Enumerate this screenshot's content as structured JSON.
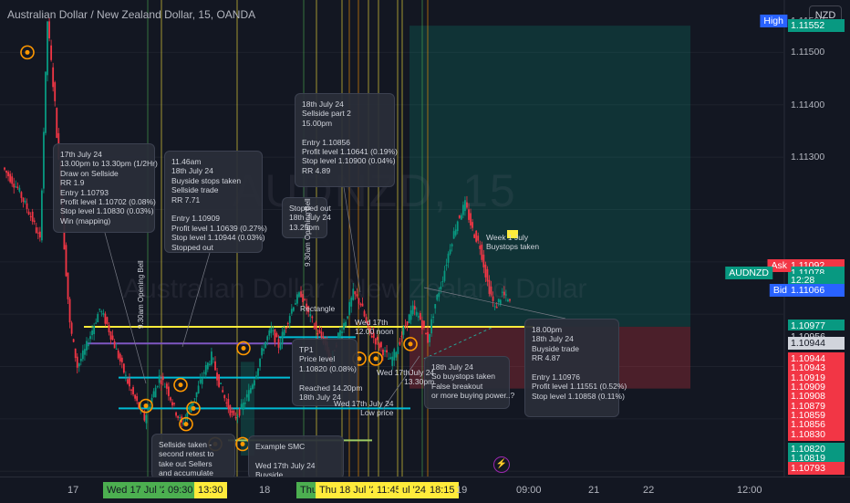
{
  "header": {
    "title": "Australian Dollar / New Zealand Dollar, 15, OANDA",
    "currency_button": "NZD"
  },
  "watermark": {
    "symbol": "AUDNZD, 15",
    "name": "Australian Dollar / New Zealand Dollar"
  },
  "price_labels": [
    {
      "text": "1.11560",
      "price": 1.1156,
      "bg": "transparent"
    },
    {
      "text": "1.11552",
      "price": 1.11552,
      "bg": "#089981"
    },
    {
      "text": "1.11500",
      "price": 1.115,
      "bg": "transparent"
    },
    {
      "text": "1.11400",
      "price": 1.114,
      "bg": "transparent"
    },
    {
      "text": "1.11300",
      "price": 1.113,
      "bg": "transparent"
    },
    {
      "text": "1.11092",
      "price": 1.11092,
      "bg": "#f23645"
    },
    {
      "text": "1.11078",
      "price": 1.11078,
      "bg": "#089981"
    },
    {
      "text": "12:28",
      "price": 1.11064,
      "bg": "#089981"
    },
    {
      "text": "1.11066",
      "price": 1.11046,
      "bg": "#2962ff"
    },
    {
      "text": "1.10977",
      "price": 1.10977,
      "bg": "#089981"
    },
    {
      "text": "1.10956",
      "price": 1.10956,
      "bg": "#131722",
      "color": "#d1d4dc"
    },
    {
      "text": "1.10944",
      "price": 1.10944,
      "bg": "#d1d4dc",
      "color": "#131722"
    },
    {
      "text": "1.10944",
      "price": 1.10915,
      "bg": "#f23645"
    },
    {
      "text": "1.10943",
      "price": 1.10897,
      "bg": "#f23645"
    },
    {
      "text": "1.10919",
      "price": 1.10879,
      "bg": "#f23645"
    },
    {
      "text": "1.10909",
      "price": 1.10861,
      "bg": "#f23645"
    },
    {
      "text": "1.10908",
      "price": 1.10843,
      "bg": "#f23645"
    },
    {
      "text": "1.10879",
      "price": 1.10825,
      "bg": "#f23645"
    },
    {
      "text": "1.10859",
      "price": 1.10807,
      "bg": "#f23645"
    },
    {
      "text": "1.10856",
      "price": 1.10789,
      "bg": "#f23645"
    },
    {
      "text": "1.10830",
      "price": 1.10771,
      "bg": "#f23645"
    },
    {
      "text": "1.10820",
      "price": 1.10743,
      "bg": "#089981"
    },
    {
      "text": "1.10819",
      "price": 1.10725,
      "bg": "#089981"
    },
    {
      "text": "1.10793",
      "price": 1.10705,
      "bg": "#f23645"
    }
  ],
  "price_tags": [
    {
      "text": "High",
      "price": 1.1156,
      "bg": "#2962ff"
    },
    {
      "text": "Ask",
      "price": 1.11092,
      "bg": "#f23645"
    },
    {
      "text": "AUDNZD",
      "price": 1.11078,
      "bg": "#089981"
    },
    {
      "text": "Bid",
      "price": 1.11046,
      "bg": "#2962ff"
    }
  ],
  "time_axis": {
    "ticks": [
      "17",
      "18",
      "19",
      "09:00",
      "21",
      "22",
      "12:00"
    ],
    "highlights": [
      {
        "text": "Wed 17 Jul '24",
        "bg": "#4caf50"
      },
      {
        "text": "09:30",
        "bg": "#4caf50"
      },
      {
        "text": "13:30",
        "bg": "#ffeb3b"
      },
      {
        "text": "Thu",
        "bg": "#4caf50"
      },
      {
        "text": "Thu 18 Jul '24",
        "bg": "#ffeb3b"
      },
      {
        "text": "11:45",
        "bg": "#ffeb3b"
      },
      {
        "text": "ul '24",
        "bg": "#ffeb3b"
      },
      {
        "text": "18:15",
        "bg": "#ffeb3b"
      }
    ]
  },
  "notes": {
    "n1": "17th July 24\n13.00pm to 13.30pm (1/2Hr)\nDraw on Sellside\nRR 1.9\nEntry 1.10793\nProfit level 1.10702 (0.08%)\nStop level 1.10830 (0.03%)\nWin (mapping)",
    "n2": "11.46am\n18th July 24\nBuyside stops taken\nSellside trade\nRR 7.71\n\nEntry 1.10909\nProfit level 1.10639 (0.27%)\nStop level 1.10944 (0.03%)\nStopped out",
    "n3": "18th July 24\nSellside part 2\n15.00pm\n\nEntry 1.10856\nProfit level 1.10641 (0.19%)\nStop level 1.10900 (0.04%)\nRR 4.89",
    "n4": "Stopped out\n18th July 24\n13.25pm",
    "n5": "TP1\nPrice level\n1.10820 (0.08%)\n\nReached 14.20pm\n18th July 24",
    "n6": "18th July 24\nSo buystops taken\nFalse breakout\nor more buying power..?",
    "n7": "18.00pm\n18th July 24\nBuyside trade\nRR 4.87\n\nEntry 1.10976\nProfit level 1.11551 (0.52%)\nStop level 1.10858 (0.11%)",
    "n8": "Sellside taken -\nsecond retest to\ntake out Sellers\nand accumulate",
    "n9": "Example SMC\n\nWed 17th July 24\nBuyside"
  },
  "labels": {
    "wed13": "Wed 17thJuly 24\n13.30pm",
    "wed11": "Wed 17th July 24\nLow price",
    "wed12": "Wed 17th\n12.00 noon",
    "rect": "Rectangle",
    "week": "Week 1 July\nBuystops taken",
    "open930": "9.30am Opening Bell",
    "open930b": "9.30am Opening Bell"
  },
  "chart_data": {
    "type": "candlestick",
    "symbol": "AUDNZD",
    "timeframe": "15",
    "source": "OANDA",
    "ylim": [
      1.1069,
      1.116
    ],
    "x_ticks": [
      "17",
      "18",
      "19",
      "09:00",
      "21",
      "22",
      "12:00"
    ],
    "close_path": [
      1.1128,
      1.1126,
      1.1124,
      1.1121,
      1.1118,
      1.1114,
      1.1156,
      1.114,
      1.1118,
      1.1098,
      1.109,
      1.1093,
      1.1097,
      1.1101,
      1.1098,
      1.1094,
      1.109,
      1.1086,
      1.1083,
      1.108,
      1.1084,
      1.1088,
      1.1086,
      1.1082,
      1.1079,
      1.1082,
      1.1085,
      1.1089,
      1.1092,
      1.1087,
      1.1083,
      1.108,
      1.1082,
      1.1085,
      1.1089,
      1.1094,
      1.1097,
      1.1094,
      1.1098,
      1.1102,
      1.1104,
      1.11,
      1.1097,
      1.1095,
      1.1091,
      1.1096,
      1.1099,
      1.1104,
      1.1102,
      1.1097,
      1.1095,
      1.1093,
      1.1091,
      1.1094,
      1.1098,
      1.1101,
      1.1099,
      1.1095,
      1.1102,
      1.1107,
      1.1113,
      1.1118,
      1.1121,
      1.1116,
      1.1113,
      1.1106,
      1.1101,
      1.1104,
      1.1102
    ],
    "series": [
      {
        "name": "Sell trade 17 Jul",
        "entry": 1.10793,
        "target": 1.10702,
        "stop": 1.1083
      },
      {
        "name": "Sell trade 18 Jul 11.46am",
        "entry": 1.10909,
        "target": 1.10639,
        "stop": 1.10944
      },
      {
        "name": "Buy trade 18 Jul 18.00pm",
        "entry": 1.10976,
        "target": 1.11551,
        "stop": 1.10858
      }
    ],
    "levels": [
      {
        "name": "yellow",
        "value": 1.10976
      },
      {
        "name": "purple",
        "value": 1.10944
      },
      {
        "name": "cyan-1",
        "value": 1.10956
      },
      {
        "name": "cyan-2",
        "value": 1.10879
      },
      {
        "name": "cyan-3",
        "value": 1.1082
      },
      {
        "name": "green",
        "value": 1.10759
      }
    ]
  },
  "colors": {
    "bull": "#089981",
    "bear": "#f23645",
    "yellow": "#ffeb3b",
    "cyan": "#00bcd4",
    "purple": "#7e57c2",
    "orange": "#ff9800",
    "green": "#4caf50"
  }
}
